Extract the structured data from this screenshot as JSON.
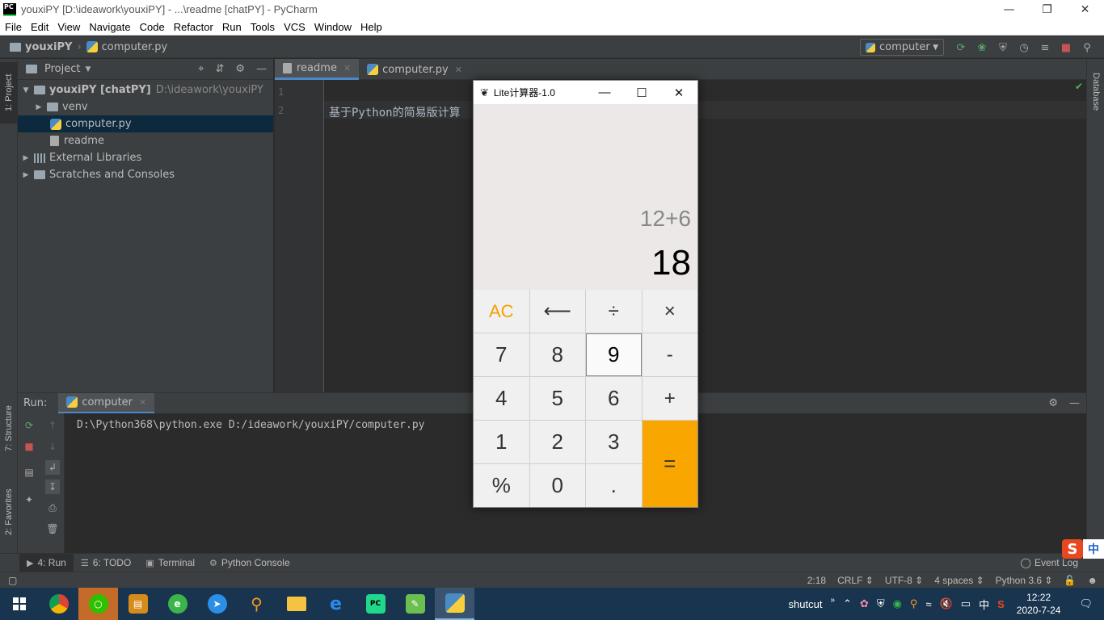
{
  "window": {
    "title": "youxiPY [D:\\ideawork\\youxiPY] - ...\\readme [chatPY] - PyCharm",
    "app_icon_text": "PC"
  },
  "menu": [
    "File",
    "Edit",
    "View",
    "Navigate",
    "Code",
    "Refactor",
    "Run",
    "Tools",
    "VCS",
    "Window",
    "Help"
  ],
  "navbar": {
    "project": "youxiPY",
    "file": "computer.py",
    "run_config": "computer"
  },
  "left_stripe": {
    "project_tab": "1: Project",
    "structure_tab": "7: Structure",
    "favorites_tab": "2: Favorites"
  },
  "right_stripe": {
    "database_tab": "Database"
  },
  "project_panel": {
    "title": "Project",
    "tree": [
      {
        "label": "youxiPY [chatPY]",
        "extra": "D:\\ideawork\\youxiPY"
      },
      {
        "label": "venv"
      },
      {
        "label": "computer.py"
      },
      {
        "label": "readme"
      },
      {
        "label": "External Libraries"
      },
      {
        "label": "Scratches and Consoles"
      }
    ]
  },
  "editor": {
    "tabs": [
      {
        "label": "readme"
      },
      {
        "label": "computer.py"
      }
    ],
    "lines": [
      "1",
      "2"
    ],
    "code": [
      "",
      "基于Python的简易版计算"
    ]
  },
  "run_panel": {
    "label": "Run:",
    "tab": "computer",
    "console": "D:\\Python368\\python.exe D:/ideawork/youxiPY/computer.py"
  },
  "bottom_tabs": [
    {
      "label": "4: Run"
    },
    {
      "label": "6: TODO"
    },
    {
      "label": "Terminal"
    },
    {
      "label": "Python Console"
    }
  ],
  "event_log": "Event Log",
  "status": {
    "position": "2:18",
    "line_sep": "CRLF",
    "encoding": "UTF-8",
    "indent": "4 spaces",
    "interpreter": "Python 3.6"
  },
  "calculator": {
    "title": "Lite计算器-1.0",
    "expression": "12+6",
    "result": "18",
    "keys": [
      "AC",
      "⟵",
      "÷",
      "×",
      "7",
      "8",
      "9",
      "-",
      "4",
      "5",
      "6",
      "+",
      "1",
      "2",
      "3",
      "=",
      "%",
      "0",
      "."
    ]
  },
  "taskbar": {
    "tray_label": "shutcut",
    "ime": "中",
    "time": "12:22",
    "date": "2020-7-24"
  },
  "colors": {
    "accent_orange": "#f9a601",
    "ide_bg": "#2b2b2b",
    "panel_bg": "#3c3f41",
    "taskbar_bg": "#18344e"
  }
}
